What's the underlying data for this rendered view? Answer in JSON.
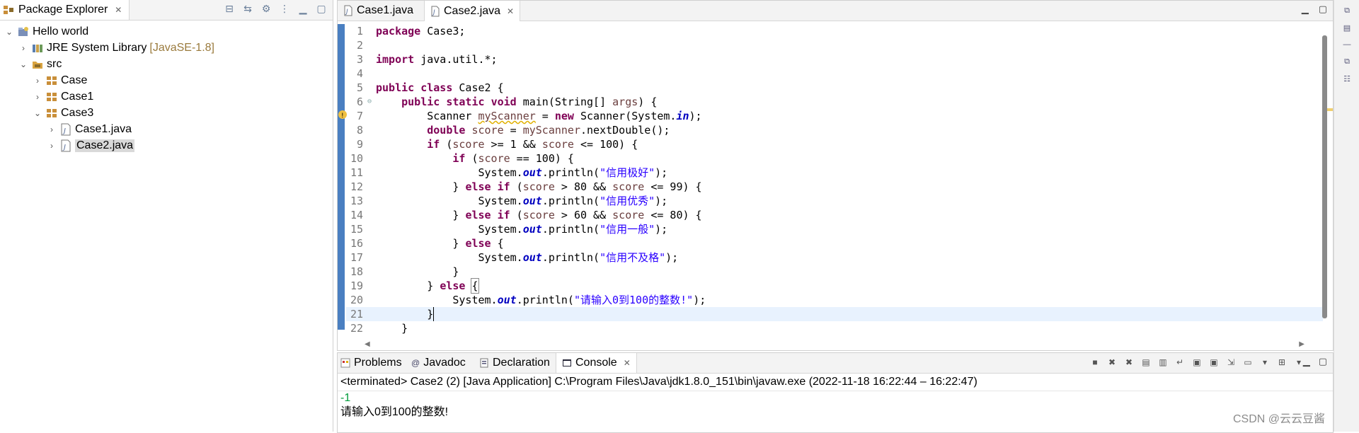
{
  "package_explorer": {
    "tab_label": "Package Explorer",
    "tree": [
      {
        "label": "Hello world",
        "decoration": "",
        "icon": "project-icon"
      },
      {
        "label": "JRE System Library",
        "decoration": "[JavaSE-1.8]",
        "icon": "library-icon"
      },
      {
        "label": "src",
        "decoration": "",
        "icon": "source-folder-icon"
      },
      {
        "label": "Case",
        "decoration": "",
        "icon": "package-icon"
      },
      {
        "label": "Case1",
        "decoration": "",
        "icon": "package-icon"
      },
      {
        "label": "Case3",
        "decoration": "",
        "icon": "package-icon"
      },
      {
        "label": "Case1.java",
        "decoration": "",
        "icon": "java-file-icon"
      },
      {
        "label": "Case2.java",
        "decoration": "",
        "icon": "java-file-icon"
      }
    ]
  },
  "editor": {
    "tabs": [
      {
        "label": "Case1.java"
      },
      {
        "label": "Case2.java"
      }
    ],
    "line_numbers": [
      "1",
      "2",
      "3",
      "4",
      "5",
      "6",
      "7",
      "8",
      "9",
      "10",
      "11",
      "12",
      "13",
      "14",
      "15",
      "16",
      "17",
      "18",
      "19",
      "20",
      "21",
      "22"
    ],
    "code": {
      "l1_kw": "package",
      "l1_rest": " Case3;",
      "l3_kw": "import",
      "l3_rest": " java.util.*;",
      "l5_kw1": "public",
      "l5_kw2": "class",
      "l5_rest": " Case2 {",
      "l6_kw1": "public",
      "l6_kw2": "static",
      "l6_kw3": "void",
      "l6_rest1": " main(String[] ",
      "l6_var": "args",
      "l6_rest2": ") {",
      "l7_a": "Scanner ",
      "l7_var": "myScanner",
      "l7_b": " = ",
      "l7_kw": "new",
      "l7_c": " Scanner(System.",
      "l7_fld": "in",
      "l7_d": ");",
      "l8_kw": "double",
      "l8_var1": "score",
      "l8_b": " = ",
      "l8_var2": "myScanner",
      "l8_c": ".nextDouble();",
      "l9_kw": "if",
      "l9_a": " (",
      "l9_var1": "score",
      "l9_b": " >= 1 && ",
      "l9_var2": "score",
      "l9_c": " <= 100) {",
      "l10_kw": "if",
      "l10_a": " (",
      "l10_var": "score",
      "l10_b": " == 100) {",
      "sys": "System.",
      "out": "out",
      "println": ".println(",
      "end": ");",
      "s11": "\"信用极好\"",
      "l12_a": "} ",
      "l12_kw": "else if",
      "l12_b": " (",
      "l12_var1": "score",
      "l12_c": " > 80 && ",
      "l12_var2": "score",
      "l12_d": " <= 99) {",
      "s13": "\"信用优秀\"",
      "l14_var1": "score",
      "l14_c": " > 60 && ",
      "l14_var2": "score",
      "l14_d": " <= 80) {",
      "s15": "\"信用一般\"",
      "l16_kw": "else",
      "l16_b": " {",
      "s17": "\"信用不及格\"",
      "close": "}",
      "l19_kw": "else",
      "l19_brace": "{",
      "s20": "\"请输入0到100的整数!\""
    }
  },
  "console": {
    "tabs": [
      {
        "label": "Problems"
      },
      {
        "label": "Javadoc"
      },
      {
        "label": "Declaration"
      },
      {
        "label": "Console"
      }
    ],
    "terminated": "<terminated> Case2 (2) [Java Application] C:\\Program Files\\Java\\jdk1.8.0_151\\bin\\javaw.exe  (2022-11-18 16:22:44 – 16:22:47)",
    "output": [
      {
        "text": "-1",
        "kind": "input"
      },
      {
        "text": "请输入0到100的整数!",
        "kind": "output"
      }
    ]
  },
  "watermark": "CSDN @云云豆酱",
  "colors": {
    "keyword": "#7f0055",
    "string": "#2a00ff",
    "local_var": "#6a3e3e",
    "static_field": "#0000c0",
    "current_line": "#e8f2fe",
    "ruler": "#4a7fc1",
    "console_input": "#009b3a"
  }
}
